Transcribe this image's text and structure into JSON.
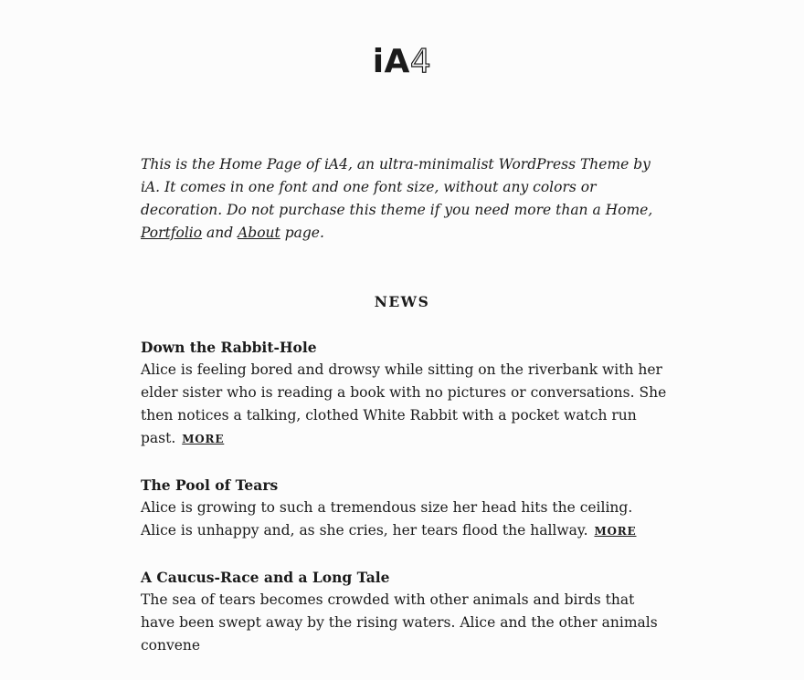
{
  "site": {
    "logo_solid": "iA",
    "logo_outline": "4"
  },
  "intro": {
    "text_before": "This is the Home Page of iA4, an ultra-minimalist WordPress Theme by iA. It comes in one font and one font size, without any colors or decoration. Do not purchase this theme if you need more than a Home, ",
    "portfolio_link": "Portfolio",
    "text_middle": " and ",
    "about_link": "About",
    "text_after": " page."
  },
  "news": {
    "title": "NEWS",
    "posts": [
      {
        "title": "Down the Rabbit-Hole",
        "excerpt": "Alice is feeling bored and drowsy while sitting on the riverbank with her elder sister who is reading a book with no pictures or conversations. She then notices a talking, clothed White Rabbit with a pocket watch run past.",
        "more_label": "MORE"
      },
      {
        "title": "The Pool of Tears",
        "excerpt": "Alice is growing to such a tremendous size her head hits the ceiling. Alice is unhappy and, as she cries, her tears flood the hallway.",
        "more_label": "MORE"
      },
      {
        "title": "A Caucus-Race and a Long Tale",
        "excerpt": "The sea of tears becomes crowded with other animals and birds that have been swept away by the rising waters. Alice and the other animals convene",
        "more_label": ""
      }
    ]
  }
}
